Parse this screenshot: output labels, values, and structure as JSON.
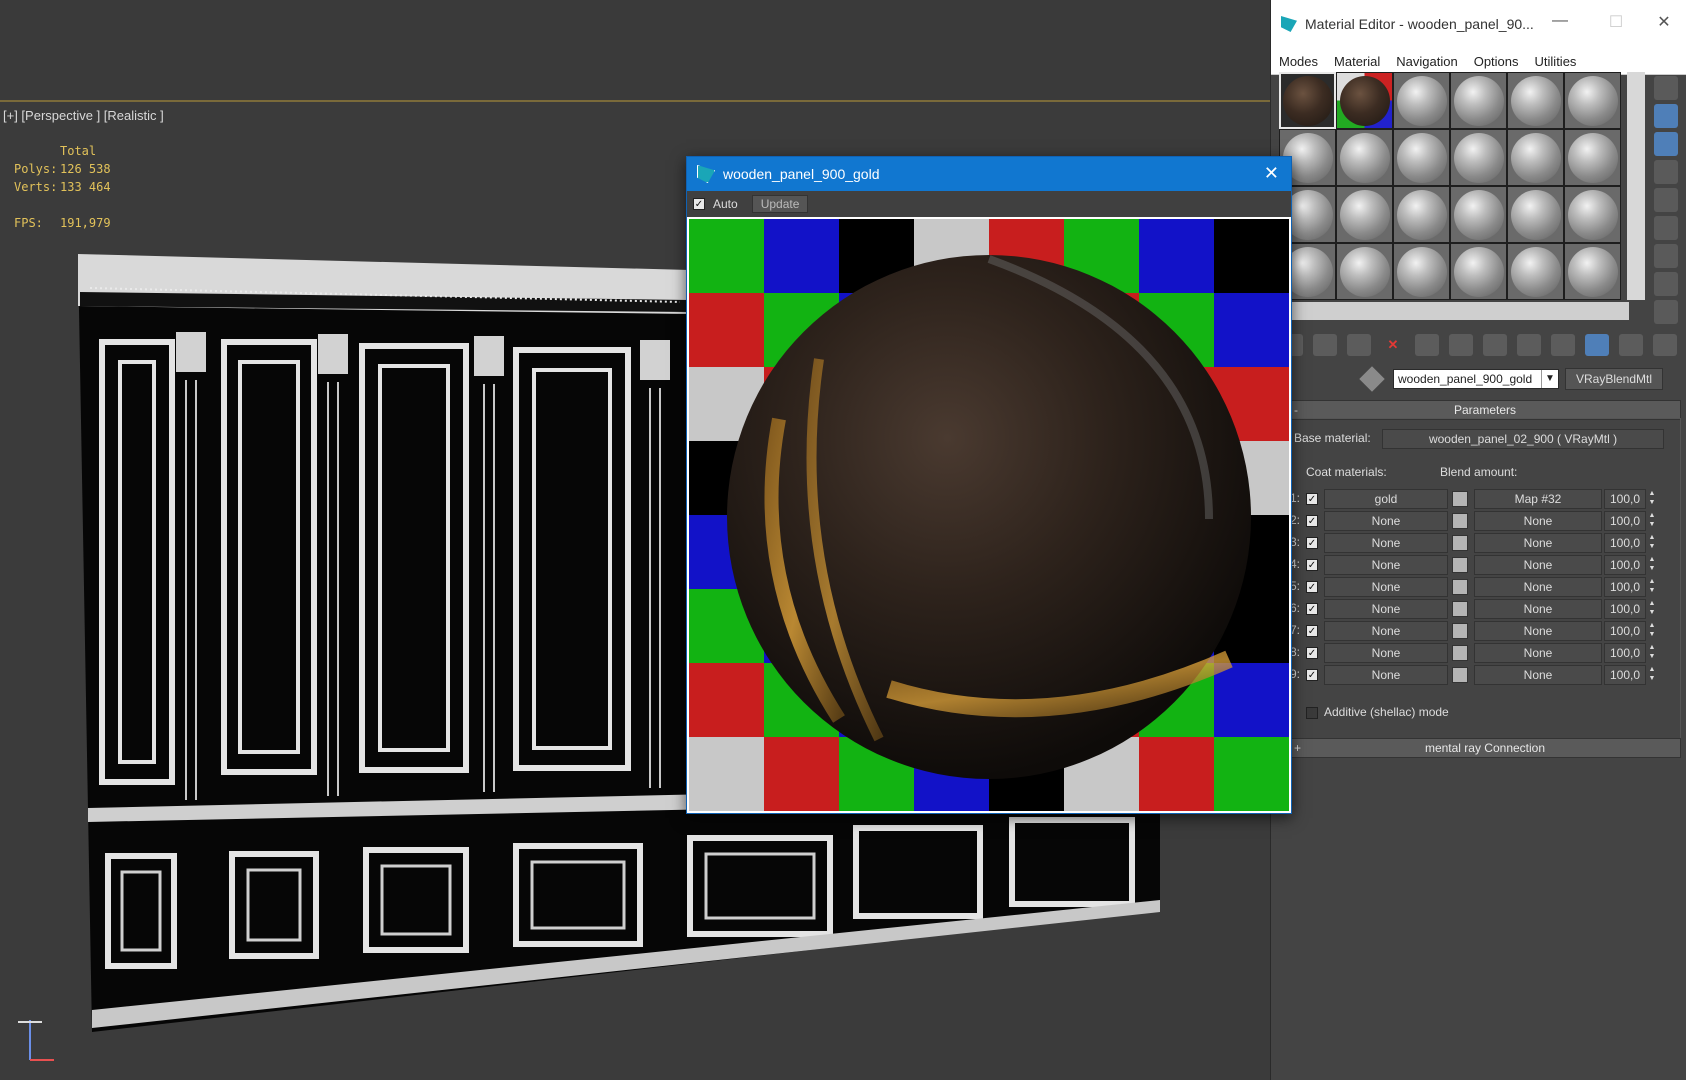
{
  "viewport": {
    "label": "[+] [Perspective ] [Realistic ]",
    "stats": {
      "total_label": "Total",
      "polys_label": "Polys:",
      "polys_value": "126 538",
      "verts_label": "Verts:",
      "verts_value": "133 464",
      "fps_label": "FPS:",
      "fps_value": "191,979"
    }
  },
  "material_editor": {
    "title": "Material Editor - wooden_panel_90...",
    "window_buttons": {
      "minimize": "—",
      "maximize": "☐",
      "close": "✕"
    },
    "menu": [
      "Modes",
      "Material",
      "Navigation",
      "Options",
      "Utilities"
    ],
    "material_name": "wooden_panel_900_gold",
    "material_type": "VRayBlendMtl",
    "parameters_rollout": "Parameters",
    "base_material_label": "Base material:",
    "base_material_value": "wooden_panel_02_900  ( VRayMtl )",
    "coat_materials_label": "Coat materials:",
    "blend_amount_label": "Blend amount:",
    "coats": [
      {
        "num": "1:",
        "material": "gold",
        "map": "Map #32",
        "amount": "100,0"
      },
      {
        "num": "2:",
        "material": "None",
        "map": "None",
        "amount": "100,0"
      },
      {
        "num": "3:",
        "material": "None",
        "map": "None",
        "amount": "100,0"
      },
      {
        "num": "4:",
        "material": "None",
        "map": "None",
        "amount": "100,0"
      },
      {
        "num": "5:",
        "material": "None",
        "map": "None",
        "amount": "100,0"
      },
      {
        "num": "6:",
        "material": "None",
        "map": "None",
        "amount": "100,0"
      },
      {
        "num": "7:",
        "material": "None",
        "map": "None",
        "amount": "100,0"
      },
      {
        "num": "8:",
        "material": "None",
        "map": "None",
        "amount": "100,0"
      },
      {
        "num": "9:",
        "material": "None",
        "map": "None",
        "amount": "100,0"
      }
    ],
    "additive_label": "Additive (shellac) mode",
    "mental_ray_rollout": "mental ray Connection",
    "minus_sign": "-",
    "plus_sign": "+"
  },
  "render_window": {
    "title": "wooden_panel_900_gold",
    "close": "✕",
    "auto_label": "Auto",
    "update_label": "Update"
  },
  "colors": {
    "title_blue": "#1177d0",
    "checker_red": "#c81e1e",
    "checker_green": "#12b312",
    "checker_blue": "#1212c8",
    "checker_gray": "#c8c8c8",
    "checker_black": "#000000"
  },
  "icons": {
    "delete": "✕",
    "check": "✓"
  }
}
